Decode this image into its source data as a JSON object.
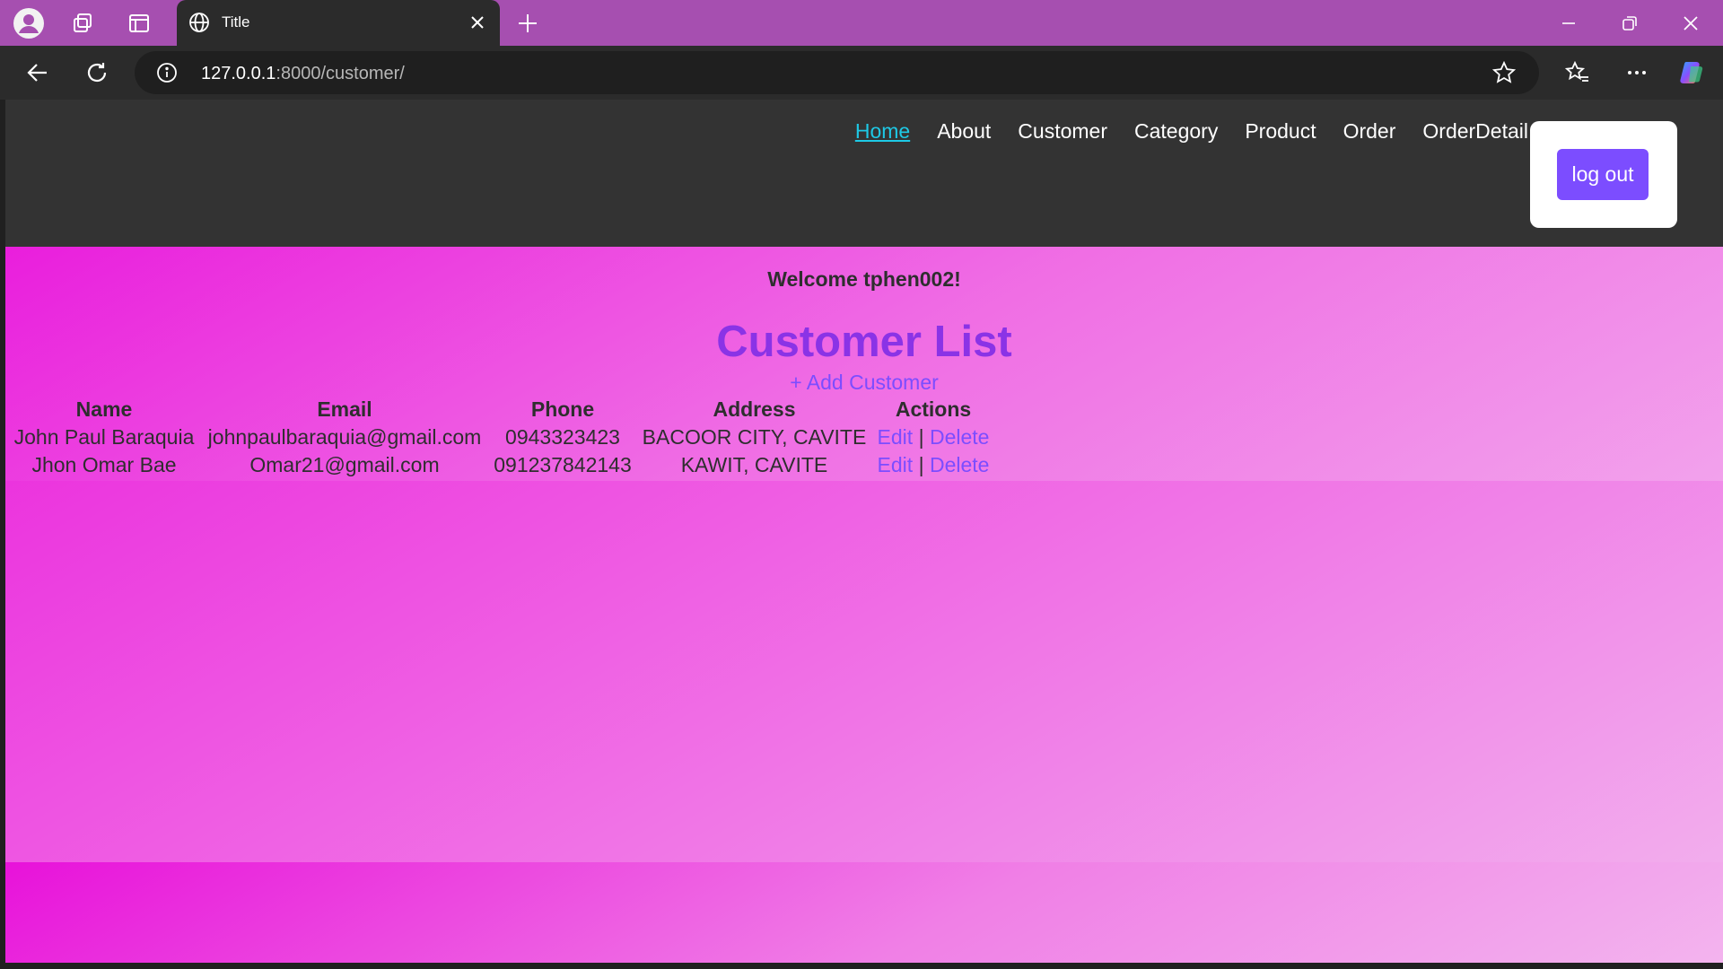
{
  "browser": {
    "tab_title": "Title",
    "url_host": "127.0.0.1",
    "url_rest": ":8000/customer/"
  },
  "nav": {
    "items": [
      "Home",
      "About",
      "Customer",
      "Category",
      "Product",
      "Order",
      "OrderDetail"
    ],
    "active": "Home",
    "logout_label": "log out"
  },
  "page": {
    "welcome": "Welcome tphen002!",
    "title": "Customer List",
    "add_link": "+ Add Customer"
  },
  "table": {
    "headers": [
      "Name",
      "Email",
      "Phone",
      "Address",
      "Actions"
    ],
    "rows": [
      {
        "name": "John Paul Baraquia",
        "email": "johnpaulbaraquia@gmail.com",
        "phone": "0943323423",
        "address": "BACOOR CITY, CAVITE",
        "edit": "Edit",
        "sep": "|",
        "delete": "Delete"
      },
      {
        "name": "Jhon Omar Bae",
        "email": "Omar21@gmail.com",
        "phone": "091237842143",
        "address": "KAWIT, CAVITE",
        "edit": "Edit",
        "sep": "|",
        "delete": "Delete"
      }
    ]
  },
  "colors": {
    "titlebar": "#a64fb0",
    "header": "#333333",
    "accent": "#7c4dff",
    "title": "#8a33e6",
    "active_nav": "#1ec9e6"
  }
}
